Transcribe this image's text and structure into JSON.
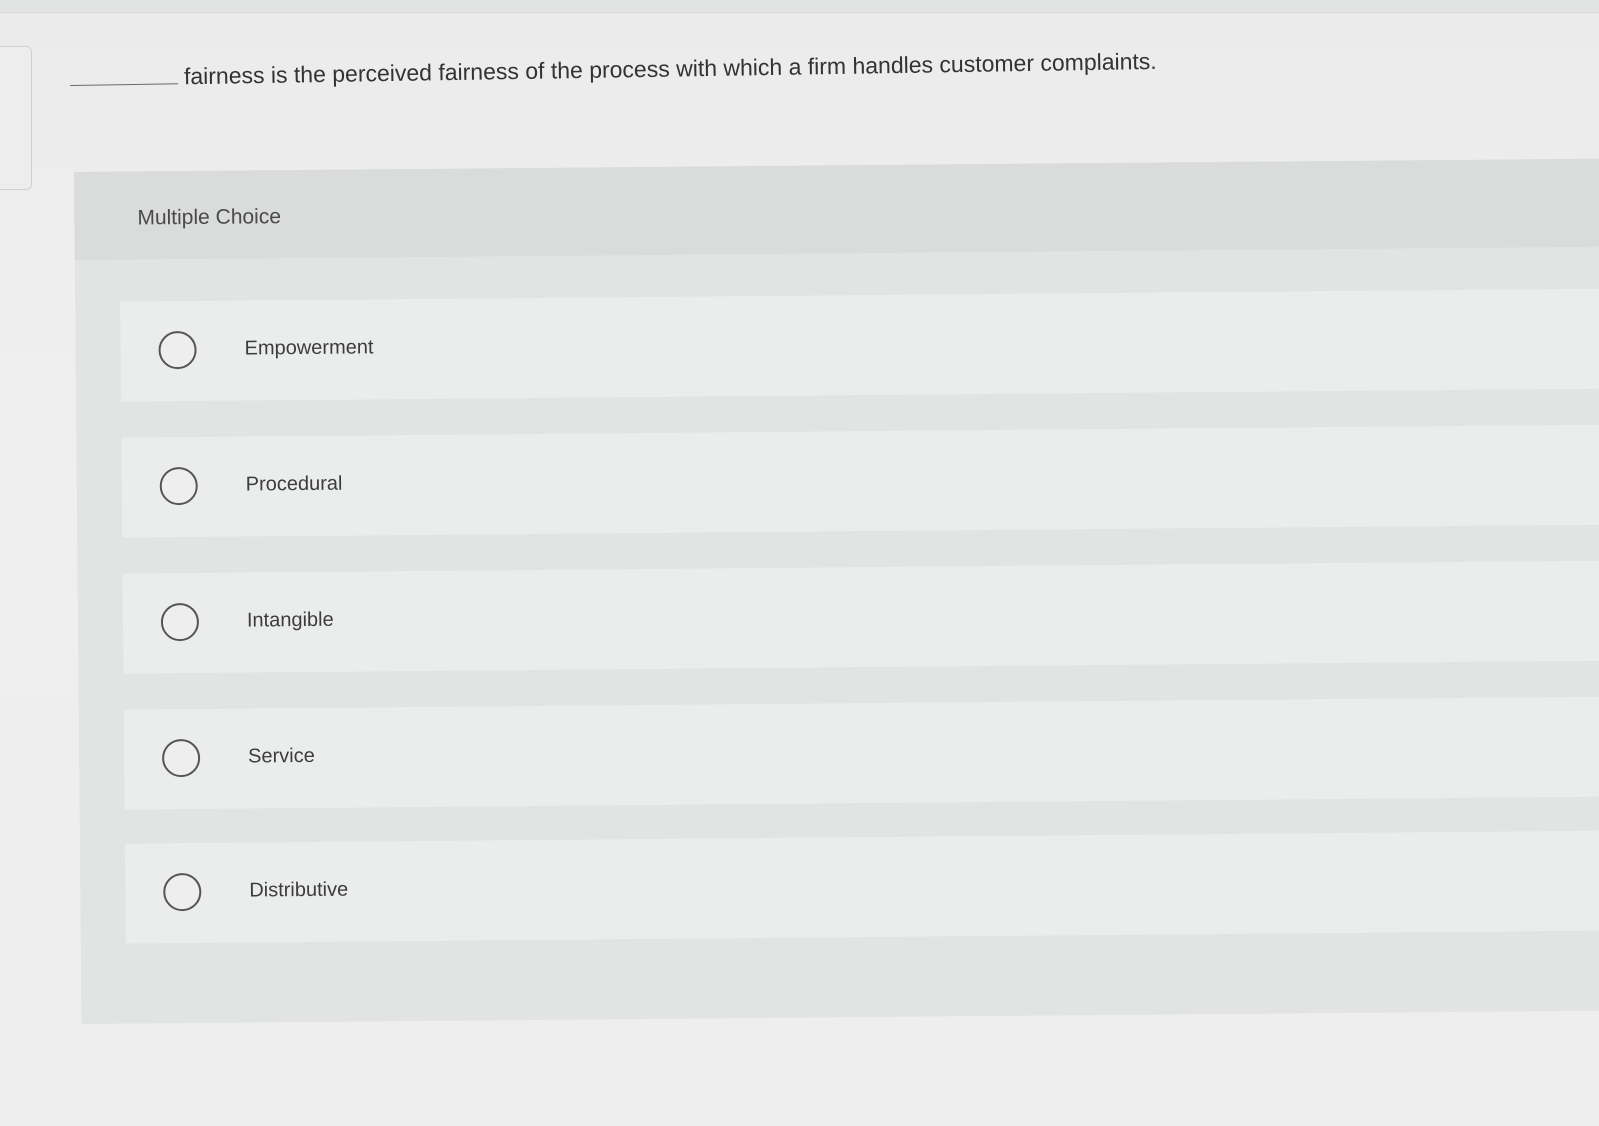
{
  "question": {
    "text": "fairness is the perceived fairness of the process with which a firm handles customer complaints."
  },
  "multiple_choice": {
    "header": "Multiple Choice",
    "options": [
      {
        "label": "Empowerment",
        "selected": false
      },
      {
        "label": "Procedural",
        "selected": false
      },
      {
        "label": "Intangible",
        "selected": false
      },
      {
        "label": "Service",
        "selected": false
      },
      {
        "label": "Distributive",
        "selected": false
      }
    ]
  }
}
